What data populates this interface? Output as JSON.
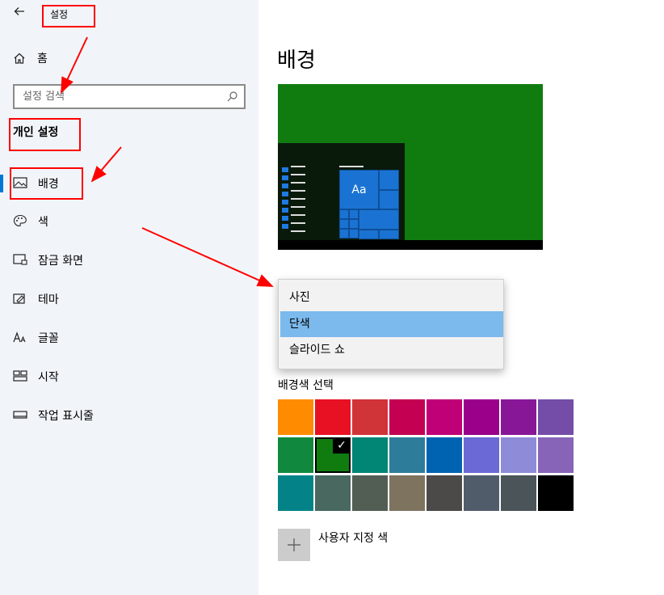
{
  "window": {
    "title": "설정"
  },
  "sidebar": {
    "home_label": "홈",
    "search_placeholder": "설정 검색",
    "section_title": "개인 설정",
    "items": [
      {
        "label": "배경",
        "icon": "picture-icon",
        "active": true
      },
      {
        "label": "색",
        "icon": "palette-icon"
      },
      {
        "label": "잠금 화면",
        "icon": "lock-screen-icon"
      },
      {
        "label": "테마",
        "icon": "theme-brush-icon"
      },
      {
        "label": "글꼴",
        "icon": "font-icon"
      },
      {
        "label": "시작",
        "icon": "start-menu-icon"
      },
      {
        "label": "작업 표시줄",
        "icon": "taskbar-icon"
      }
    ]
  },
  "main": {
    "title": "배경",
    "preview": {
      "tile_text": "Aa",
      "background_color": "#107c10"
    },
    "background_dropdown": {
      "options": [
        "사진",
        "단색",
        "슬라이드 쇼"
      ],
      "selected": "단색"
    },
    "color_section_label": "배경색 선택",
    "swatches": [
      [
        "#ff8c00",
        "#e81123",
        "#d13438",
        "#c30052",
        "#bf0077",
        "#9a0089",
        "#881798",
        "#744da9"
      ],
      [
        "#10893e",
        "#107c10",
        "#018574",
        "#2d7d9a",
        "#0063b1",
        "#6b69d6",
        "#8e8cd8",
        "#8764b8"
      ],
      [
        "#038387",
        "#486860",
        "#525e54",
        "#7e735f",
        "#4c4a48",
        "#515c6b",
        "#4a5459",
        "#000000"
      ]
    ],
    "selected_swatch": "#107c10",
    "custom_color_label": "사용자 지정 색"
  },
  "colors": {
    "accent": "#0078d7",
    "annotation": "#ff0000",
    "dropdown_highlight": "#7cb9ec"
  }
}
